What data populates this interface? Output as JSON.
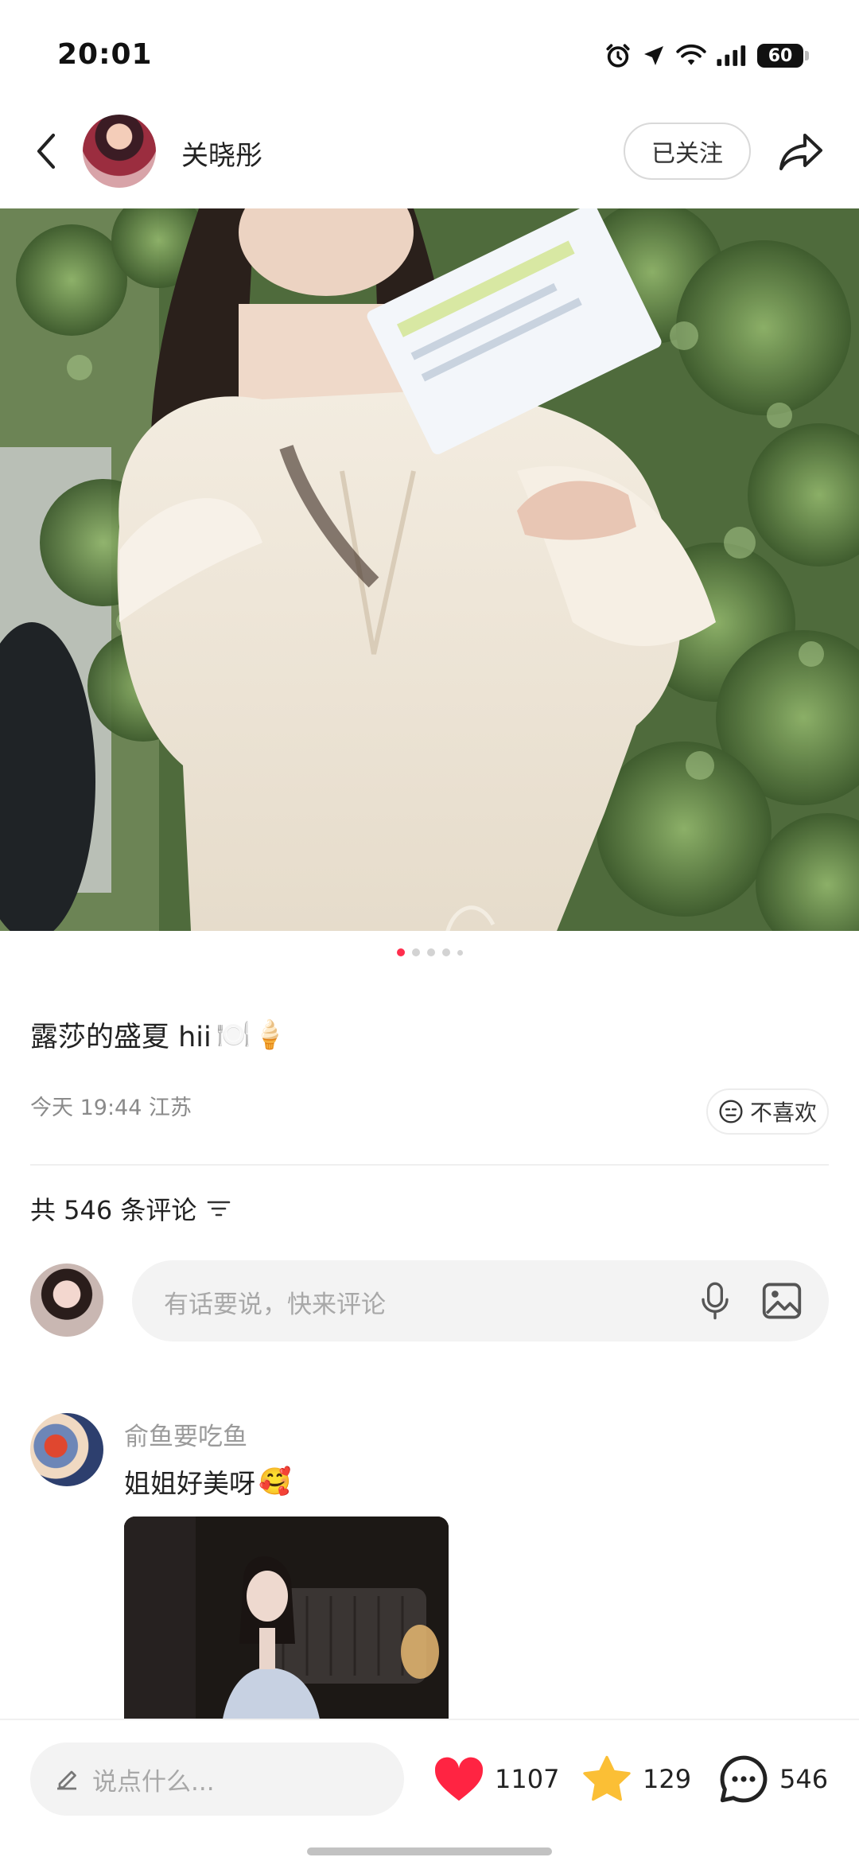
{
  "status_bar": {
    "time": "20:01",
    "battery": "60"
  },
  "header": {
    "author_name": "关晓彤",
    "follow_label": "已关注"
  },
  "carousel": {
    "current_index": 1,
    "total": 5
  },
  "post": {
    "title": "露莎的盛夏 hii",
    "title_emoji_1": "🍽️",
    "title_emoji_2": "🍦",
    "meta": "今天 19:44 江苏",
    "dislike_label": "不喜欢"
  },
  "comments": {
    "count_label": "共 546 条评论",
    "input_placeholder": "有话要说，快来评论",
    "items": [
      {
        "user": "俞鱼要吃鱼",
        "text": "姐姐好美呀",
        "emoji": "🥰"
      }
    ]
  },
  "bottom_bar": {
    "input_placeholder": "说点什么...",
    "likes": "1107",
    "stars": "129",
    "comments": "546"
  },
  "colors": {
    "accent": "#ff2e4d",
    "like": "#ff2442",
    "star": "#fbbf35"
  }
}
